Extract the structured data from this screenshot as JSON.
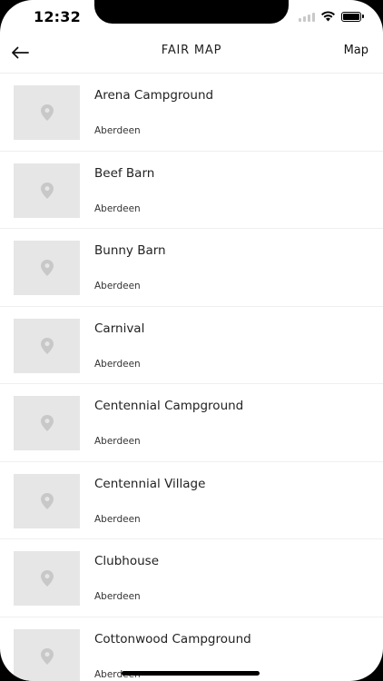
{
  "status": {
    "time": "12:32"
  },
  "nav": {
    "title": "FAIR MAP",
    "map_label": "Map"
  },
  "icons": {
    "back": "arrow-left-icon",
    "placeholder": "location-pin-icon",
    "wifi": "wifi-icon",
    "battery": "battery-icon"
  },
  "colors": {
    "background": "#ffffff",
    "placeholder": "#e6e6e6",
    "pin": "#c8c8c8"
  },
  "locations": [
    {
      "name": "Arena Campground",
      "city": "Aberdeen"
    },
    {
      "name": "Beef Barn",
      "city": "Aberdeen"
    },
    {
      "name": "Bunny Barn",
      "city": "Aberdeen"
    },
    {
      "name": "Carnival",
      "city": "Aberdeen"
    },
    {
      "name": "Centennial Campground",
      "city": "Aberdeen"
    },
    {
      "name": "Centennial Village",
      "city": "Aberdeen"
    },
    {
      "name": "Clubhouse",
      "city": "Aberdeen"
    },
    {
      "name": "Cottonwood Campground",
      "city": "Aberdeen"
    }
  ]
}
